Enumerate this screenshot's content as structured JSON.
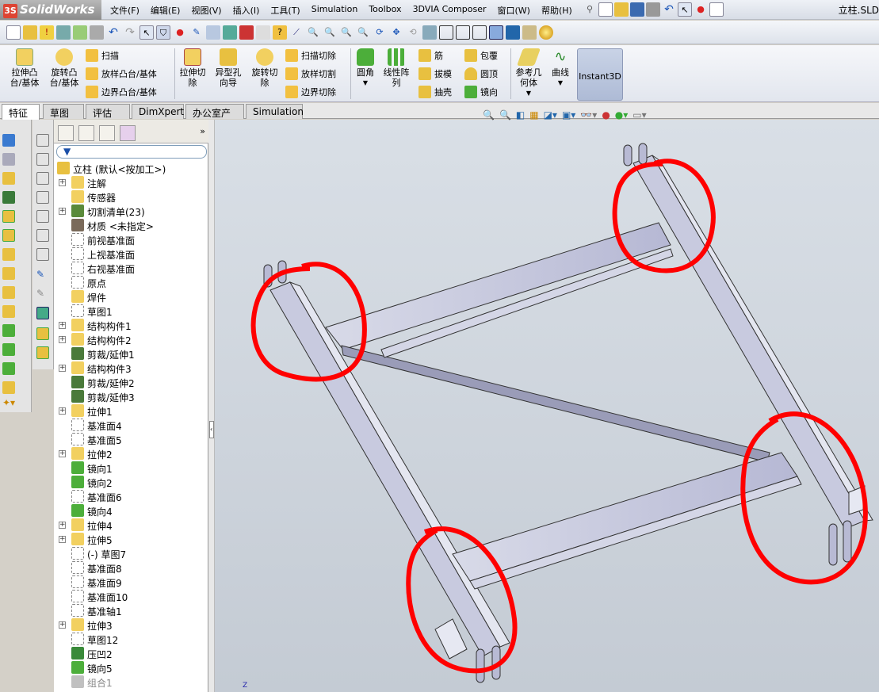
{
  "app": {
    "logo_text": "SolidWorks",
    "logo_badge": "3S",
    "window_title": "立柱.SLD"
  },
  "menu": [
    "文件(F)",
    "编辑(E)",
    "视图(V)",
    "插入(I)",
    "工具(T)",
    "Simulation",
    "Toolbox",
    "3DVIA Composer",
    "窗口(W)",
    "帮助(H)"
  ],
  "ribbon": {
    "extrude_boss": "拉伸凸\n台/基体",
    "revolve_boss": "旋转凸\n台/基体",
    "sweep": "扫描",
    "loft_boss": "放样凸台/基体",
    "boundary_boss": "边界凸台/基体",
    "extrude_cut": "拉伸切\n除",
    "hole_wizard": "异型孔\n向导",
    "revolve_cut": "旋转切\n除",
    "sweep_cut": "扫描切除",
    "loft_cut": "放样切割",
    "boundary_cut": "边界切除",
    "fillet": "圆角",
    "linear_pattern": "线性阵\n列",
    "rib": "筋",
    "draft": "拔模",
    "shell": "抽壳",
    "wrap": "包覆",
    "dome": "圆顶",
    "mirror": "镜向",
    "ref_geometry": "参考几\n何体",
    "curves": "曲线",
    "instant3d": "Instant3D"
  },
  "tabs": [
    "特征",
    "草图",
    "评估",
    "DimXpert",
    "办公室产品",
    "Simulation"
  ],
  "tree": {
    "root": "立柱  (默认<按加工>)",
    "items": [
      {
        "label": "注解",
        "icon": "annotation-icon",
        "exp": true
      },
      {
        "label": "传感器",
        "icon": "sensor-icon",
        "exp": false
      },
      {
        "label": "切割清单(23)",
        "icon": "cutlist-icon",
        "exp": true
      },
      {
        "label": "材质 <未指定>",
        "icon": "material-icon",
        "exp": false
      },
      {
        "label": "前视基准面",
        "icon": "plane-icon",
        "exp": false
      },
      {
        "label": "上视基准面",
        "icon": "plane-icon",
        "exp": false
      },
      {
        "label": "右视基准面",
        "icon": "plane-icon",
        "exp": false
      },
      {
        "label": "原点",
        "icon": "origin-icon",
        "exp": false
      },
      {
        "label": "焊件",
        "icon": "weldment-icon",
        "exp": false
      },
      {
        "label": "草图1",
        "icon": "sketch-icon",
        "exp": false
      },
      {
        "label": "结构构件1",
        "icon": "structural-member-icon",
        "exp": true
      },
      {
        "label": "结构构件2",
        "icon": "structural-member-icon",
        "exp": true
      },
      {
        "label": "剪裁/延伸1",
        "icon": "trim-extend-icon",
        "exp": false
      },
      {
        "label": "结构构件3",
        "icon": "structural-member-icon",
        "exp": true
      },
      {
        "label": "剪裁/延伸2",
        "icon": "trim-extend-icon",
        "exp": false
      },
      {
        "label": "剪裁/延伸3",
        "icon": "trim-extend-icon",
        "exp": false
      },
      {
        "label": "拉伸1",
        "icon": "extrude-icon",
        "exp": true
      },
      {
        "label": "基准面4",
        "icon": "plane-icon",
        "exp": false
      },
      {
        "label": "基准面5",
        "icon": "plane-icon",
        "exp": false
      },
      {
        "label": "拉伸2",
        "icon": "extrude-icon",
        "exp": true
      },
      {
        "label": "镜向1",
        "icon": "mirror-icon",
        "exp": false
      },
      {
        "label": "镜向2",
        "icon": "mirror-icon",
        "exp": false
      },
      {
        "label": "基准面6",
        "icon": "plane-icon",
        "exp": false
      },
      {
        "label": "镜向4",
        "icon": "mirror-icon",
        "exp": false
      },
      {
        "label": "拉伸4",
        "icon": "extrude-icon",
        "exp": true
      },
      {
        "label": "拉伸5",
        "icon": "extrude-icon",
        "exp": true
      },
      {
        "label": "(-) 草图7",
        "icon": "sketch-icon",
        "exp": false
      },
      {
        "label": "基准面8",
        "icon": "plane-icon",
        "exp": false
      },
      {
        "label": "基准面9",
        "icon": "plane-icon",
        "exp": false
      },
      {
        "label": "基准面10",
        "icon": "plane-icon",
        "exp": false
      },
      {
        "label": "基准轴1",
        "icon": "axis-icon",
        "exp": false
      },
      {
        "label": "拉伸3",
        "icon": "extrude-icon",
        "exp": true
      },
      {
        "label": "草图12",
        "icon": "sketch-icon",
        "exp": false
      },
      {
        "label": "压凹2",
        "icon": "indent-icon",
        "exp": false
      },
      {
        "label": "镜向5",
        "icon": "mirror-icon",
        "exp": false
      },
      {
        "label": "组合1",
        "icon": "combine-icon",
        "exp": false
      }
    ]
  },
  "viewport": {
    "axis_label": "Z"
  },
  "colors": {
    "accent": "#e0e7f2",
    "annotation_circle": "#ff0000",
    "model_face": "#c6c8e2"
  }
}
